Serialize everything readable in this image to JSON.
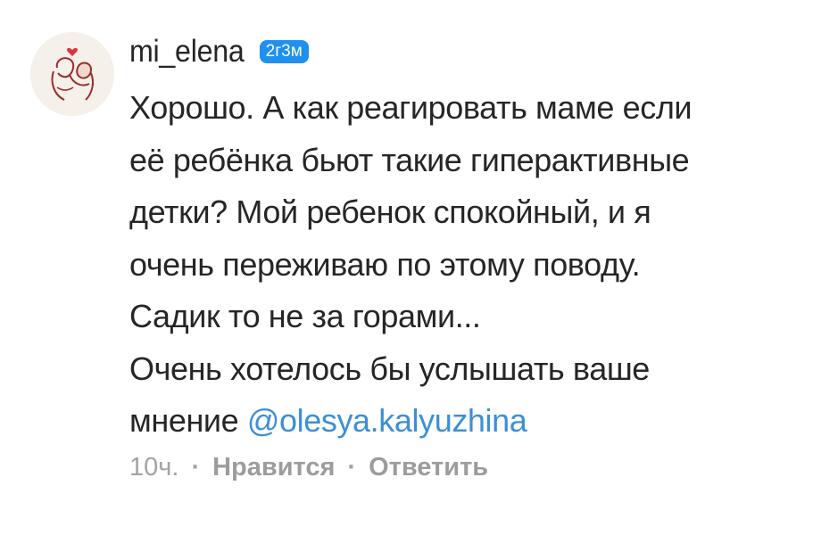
{
  "comment": {
    "username": "mi_elena",
    "badge": "2г3м",
    "lines": [
      "Хорошо. А как реагировать маме если",
      "её ребёнка бьют такие гиперактивные",
      "детки? Мой ребенок спокойный, и я",
      "очень переживаю по этому поводу.",
      "Садик то не за горами...",
      "Очень хотелось бы услышать ваше"
    ],
    "last_line_prefix": "мнение ",
    "mention": "@olesya.kalyuzhina",
    "time": "10ч.",
    "separator": "·",
    "like_label": "Нравится",
    "reply_label": "Ответить"
  },
  "colors": {
    "text": "#262626",
    "mention": "#3d8fd6",
    "badge": "#1f8ff0",
    "meta": "#a3a3a3"
  },
  "icons": {
    "avatar": "mother-child-heart-logo"
  }
}
